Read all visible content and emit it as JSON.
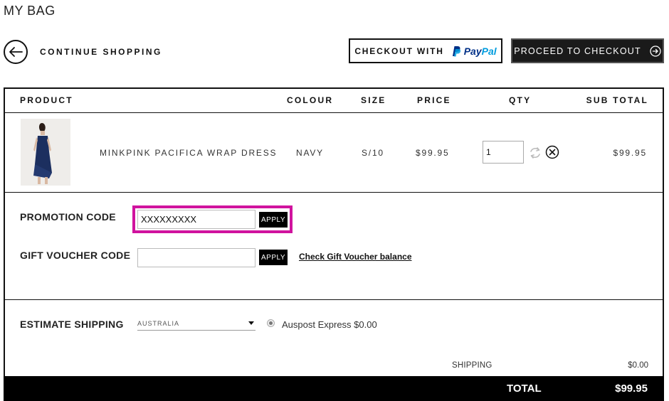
{
  "page": {
    "title": "MY BAG"
  },
  "nav": {
    "continue_label": "CONTINUE SHOPPING"
  },
  "actions": {
    "paypal_label": "CHECKOUT WITH",
    "paypal_brand_pay": "Pay",
    "paypal_brand_pal": "Pal",
    "checkout_label": "PROCEED TO CHECKOUT"
  },
  "table": {
    "headers": {
      "product": "PRODUCT",
      "colour": "COLOUR",
      "size": "SIZE",
      "price": "PRICE",
      "qty": "QTY",
      "subtotal": "SUB TOTAL"
    },
    "items": [
      {
        "name": "MINKPINK PACIFICA WRAP DRESS",
        "colour": "NAVY",
        "size": "S/10",
        "price": "$99.95",
        "qty": "1",
        "subtotal": "$99.95"
      }
    ]
  },
  "promo": {
    "label": "PROMOTION CODE",
    "value": "XXXXXXXXX",
    "apply_label": "APPLY",
    "highlight_color": "#d0139e"
  },
  "gift": {
    "label": "GIFT VOUCHER CODE",
    "value": "",
    "apply_label": "APPLY",
    "balance_link": "Check Gift Voucher balance"
  },
  "shipping": {
    "label": "ESTIMATE SHIPPING",
    "country": "AUSTRALIA",
    "option_label": "Auspost Express $0.00",
    "summary_label": "SHIPPING",
    "summary_value": "$0.00"
  },
  "total": {
    "label": "TOTAL",
    "value": "$99.95"
  },
  "colors": {
    "accent": "#000000",
    "paypal_dark": "#003087",
    "paypal_light": "#009cde"
  }
}
